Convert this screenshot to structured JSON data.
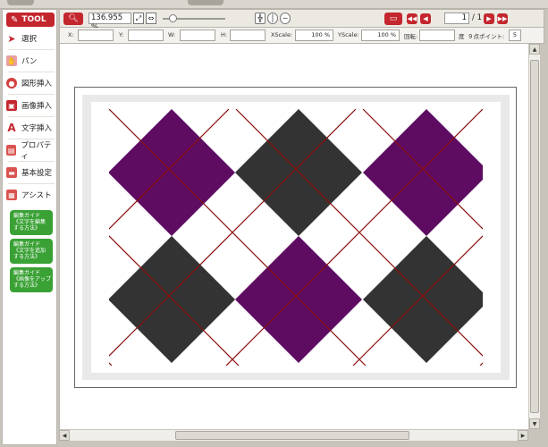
{
  "tool_header": {
    "label": "TOOL"
  },
  "sidebar": {
    "items": [
      {
        "label": "選択",
        "icon": "arrow-cursor-icon"
      },
      {
        "label": "パン",
        "icon": "hand-icon"
      },
      {
        "label": "図形挿入",
        "icon": "shape-icon"
      },
      {
        "label": "画像挿入",
        "icon": "image-icon"
      },
      {
        "label": "文字挿入",
        "icon": "text-icon"
      },
      {
        "label": "プロパティ",
        "icon": "properties-icon"
      },
      {
        "label": "基本設定",
        "icon": "settings-icon"
      },
      {
        "label": "アシスト",
        "icon": "assist-icon"
      }
    ],
    "guides": [
      {
        "line1": "編集ガイド",
        "line2": "《文字を編集",
        "line3": "する方法》"
      },
      {
        "line1": "編集ガイド",
        "line2": "《文字を追加",
        "line3": "する方法》"
      },
      {
        "line1": "編集ガイド",
        "line2": "《画像をアップ",
        "line3": "する方法》"
      }
    ]
  },
  "toolbar": {
    "zoom_value": "136.955 %",
    "page_current": "1",
    "page_total": "/ 1"
  },
  "fields": {
    "x_label": "X:",
    "y_label": "Y:",
    "w_label": "W:",
    "h_label": "H:",
    "xscale_label": "XScale:",
    "xscale_value": "100 %",
    "yscale_label": "YScale:",
    "yscale_value": "100 %",
    "rotate_label": "回転:",
    "degree_label": "度",
    "snap_label": "９点ポイント:",
    "snap_value": "5"
  },
  "colors": {
    "accent_red": "#c4262e",
    "guide_green": "#3aa135",
    "argyle_purple": "#5e0c62",
    "argyle_dark": "#333333",
    "argyle_line": "#8b0f0f"
  }
}
